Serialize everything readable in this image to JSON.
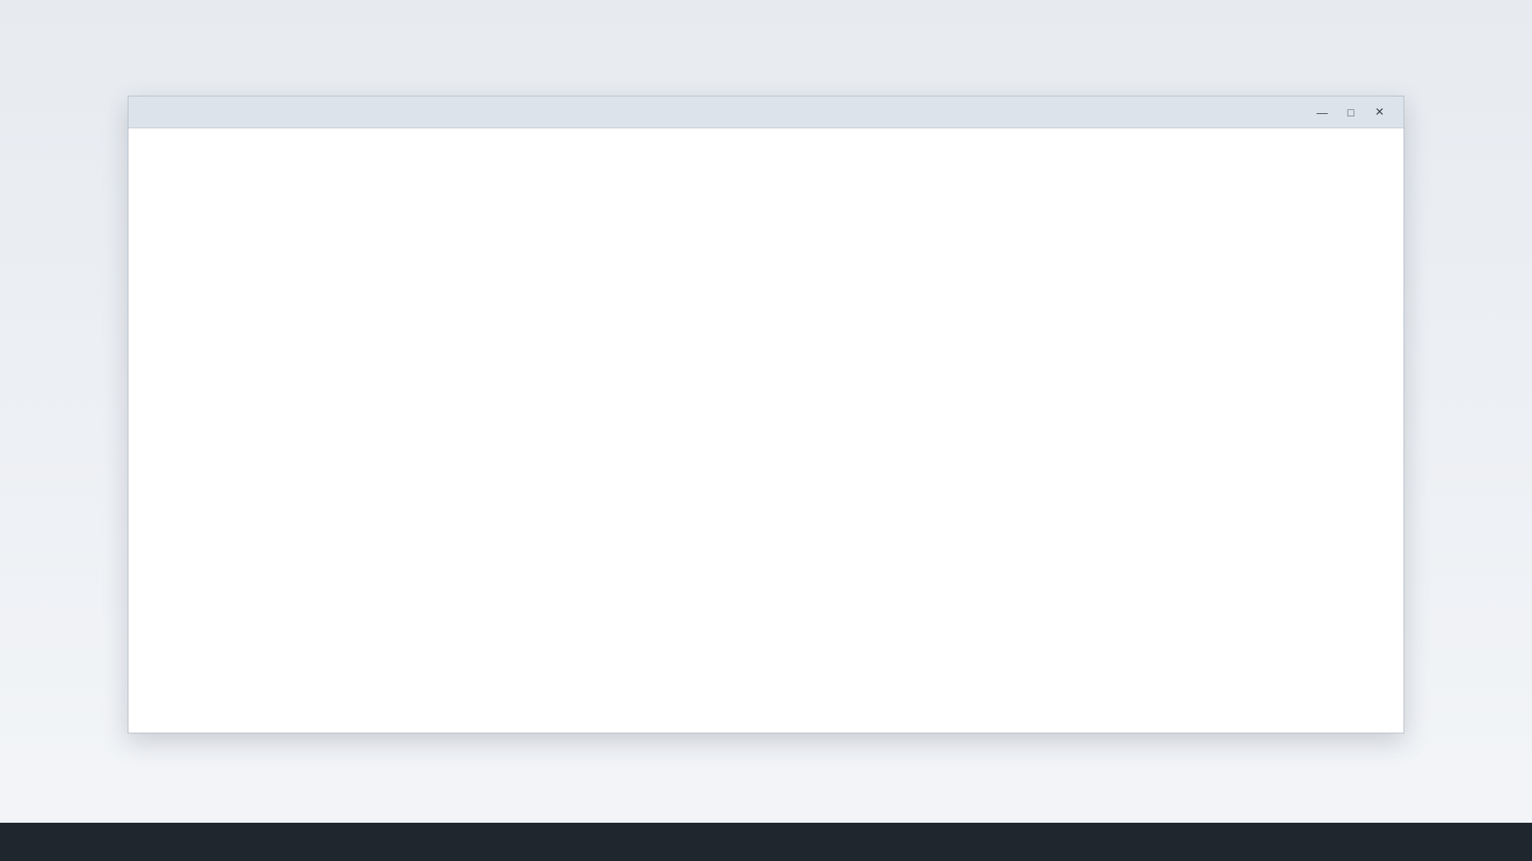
{
  "window": {
    "title": "",
    "controls": {
      "minimize_icon": "minimize-icon",
      "maximize_icon": "maximize-icon",
      "close_icon": "close-icon"
    }
  },
  "content": {
    "text": ""
  }
}
